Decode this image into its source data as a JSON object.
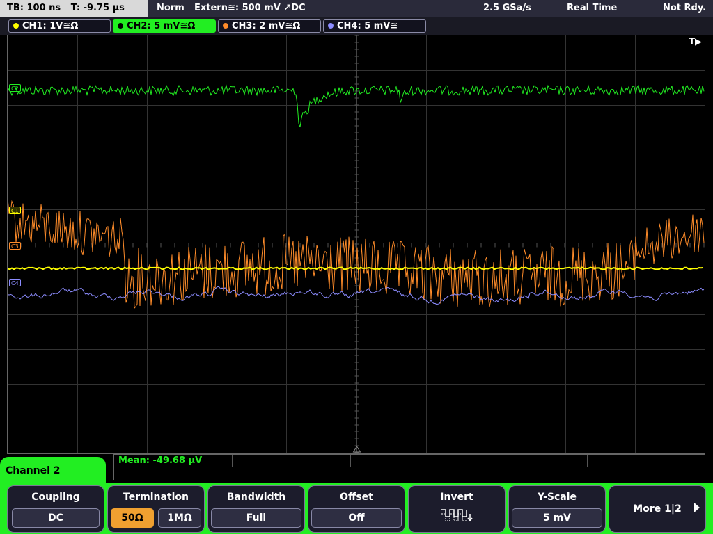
{
  "topbar": {
    "tb": "TB: 100 ns",
    "trig_time": "T: -9.75 µs",
    "mode": "Norm",
    "trigger": "Extern≅: 500 mV ↗DC",
    "sample_rate": "2.5 GSa/s",
    "acq_mode": "Real Time",
    "status": "Not Rdy."
  },
  "channels": [
    {
      "label": "CH1: 1V≅Ω",
      "color": "#ffff00"
    },
    {
      "label": "CH2: 5 mV≅Ω",
      "color": "#22ee22"
    },
    {
      "label": "CH3: 2 mV≅Ω",
      "color": "#ff8c2a"
    },
    {
      "label": "CH4: 5 mV≅",
      "color": "#8c8cff"
    }
  ],
  "markers": {
    "c2": "C2",
    "c1": "C1",
    "c3": "C3",
    "c4": "C4",
    "trigger_pos": "T▶"
  },
  "measurement": {
    "mean": "Mean: -49.68 µV"
  },
  "menu": {
    "title": "Channel 2",
    "coupling": {
      "title": "Coupling",
      "value": "DC"
    },
    "termination": {
      "title": "Termination",
      "opt1": "50Ω",
      "opt2": "1MΩ"
    },
    "bandwidth": {
      "title": "Bandwidth",
      "value": "Full"
    },
    "offset": {
      "title": "Offset",
      "value": "Off"
    },
    "invert": {
      "title": "Invert",
      "icon": "inverted-square-wave-icon"
    },
    "yscale": {
      "title": "Y-Scale",
      "value": "5 mV"
    },
    "more": "More 1|2"
  }
}
